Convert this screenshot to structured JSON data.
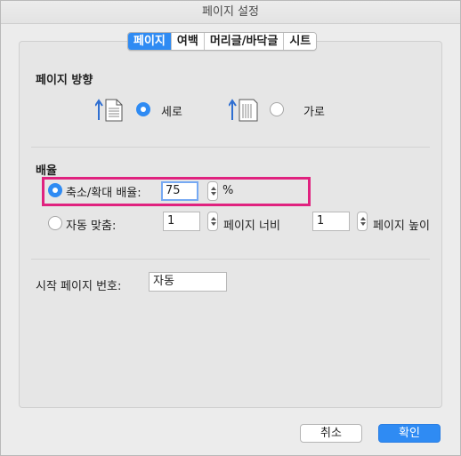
{
  "window": {
    "title": "페이지 설정"
  },
  "tabs": [
    {
      "label": "페이지",
      "active": true
    },
    {
      "label": "여백",
      "active": false
    },
    {
      "label": "머리글/바닥글",
      "active": false
    },
    {
      "label": "시트",
      "active": false
    }
  ],
  "orientation": {
    "heading": "페이지 방향",
    "portrait_label": "세로",
    "landscape_label": "가로",
    "selected": "portrait"
  },
  "scaling": {
    "heading": "배율",
    "adjust_label": "축소/확대 배율:",
    "adjust_value": "75",
    "percent_sign": "%",
    "fit_label": "자동 맞춤:",
    "fit_wide_value": "1",
    "fit_wide_label": "페이지 너비",
    "fit_tall_value": "1",
    "fit_tall_label": "페이지 높이",
    "selected": "adjust"
  },
  "first_page": {
    "label": "시작 페이지 번호:",
    "value": "자동"
  },
  "buttons": {
    "cancel": "취소",
    "ok": "확인"
  },
  "colors": {
    "accent": "#2f8bf3",
    "highlight": "#e0227f"
  }
}
